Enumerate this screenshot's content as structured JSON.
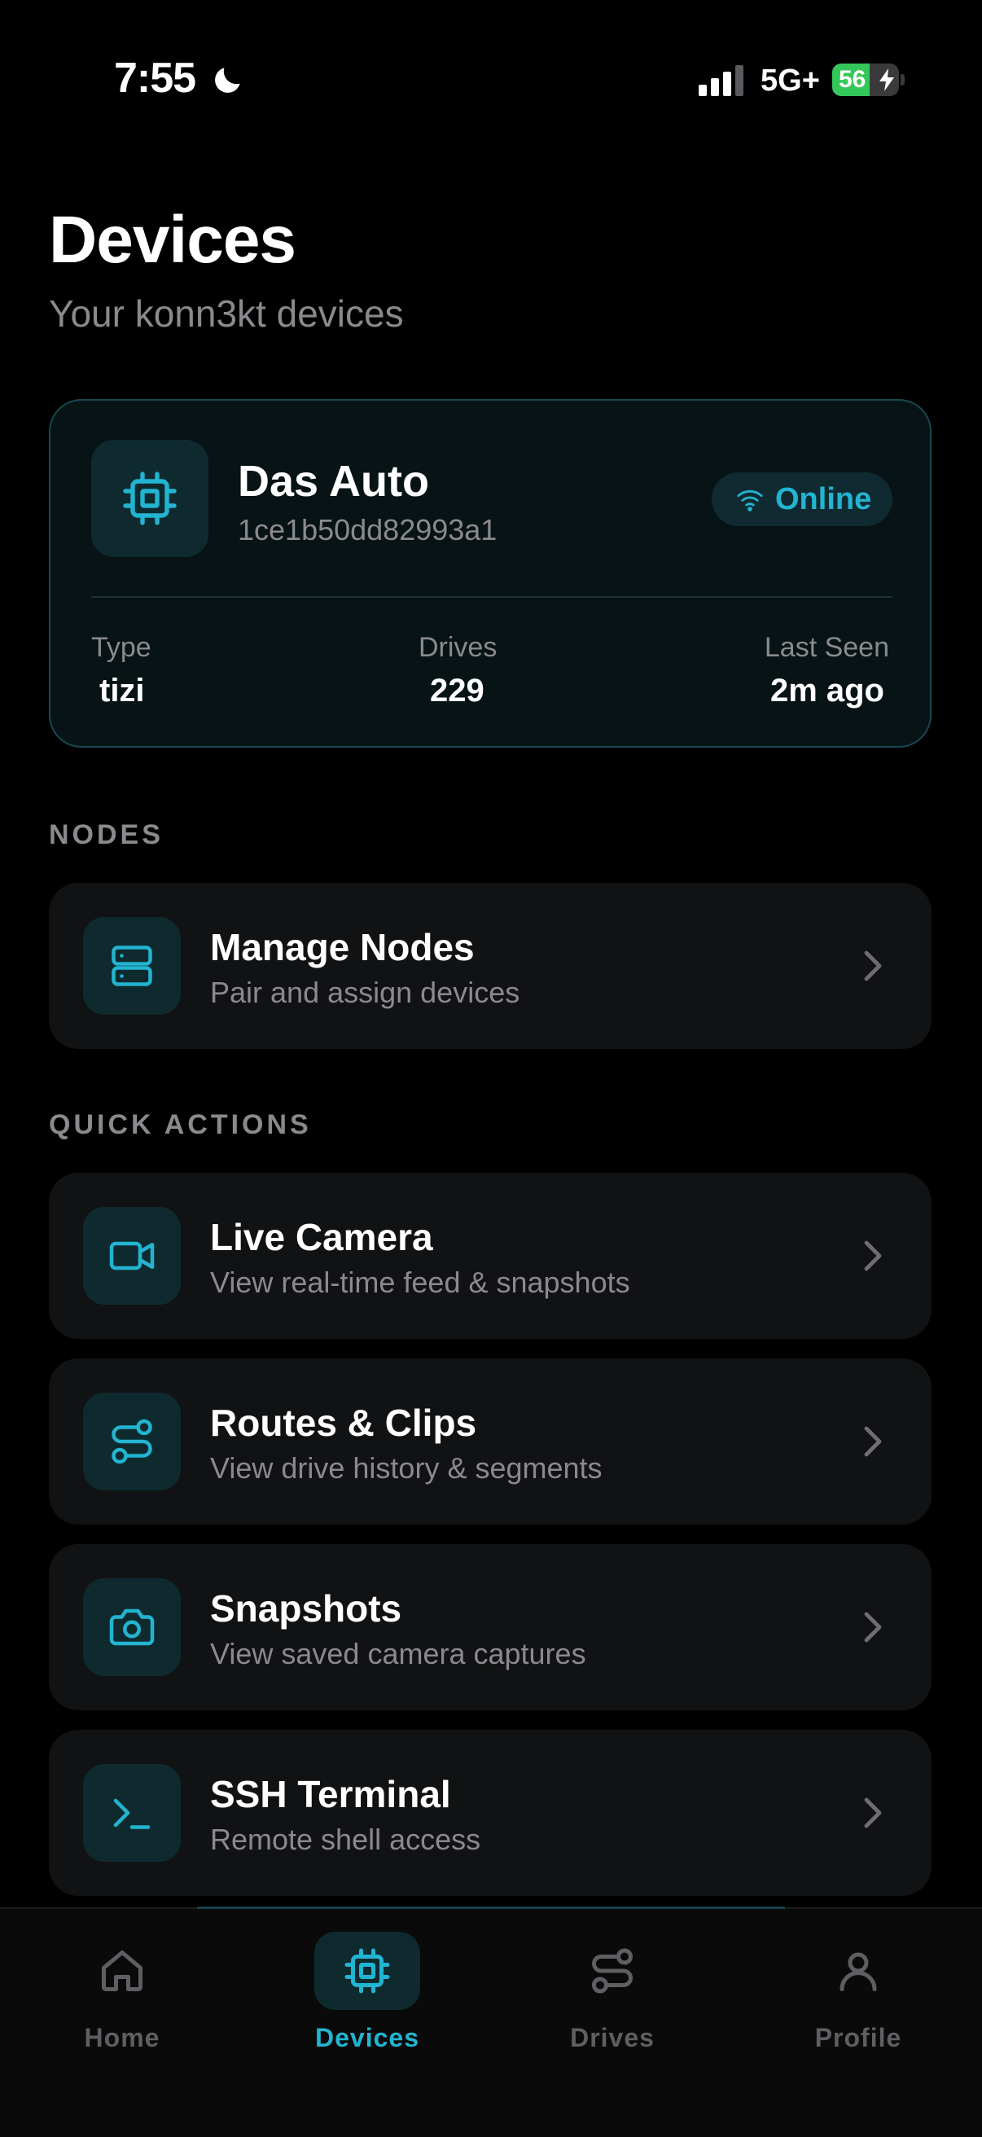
{
  "status_bar": {
    "time": "7:55",
    "network": "5G+",
    "battery_level": "56",
    "battery_fraction": 0.56,
    "moon_icon": "moon-icon",
    "signal_icon": "cellular-signal-icon",
    "bolt_icon": "charging-bolt-icon"
  },
  "header": {
    "title": "Devices",
    "subtitle": "Your konn3kt devices"
  },
  "device_card": {
    "icon": "chip-icon",
    "name": "Das Auto",
    "id": "1ce1b50dd82993a1",
    "status": "Online",
    "status_icon": "wifi-icon",
    "stats": [
      {
        "label": "Type",
        "value": "tizi"
      },
      {
        "label": "Drives",
        "value": "229"
      },
      {
        "label": "Last Seen",
        "value": "2m ago"
      }
    ]
  },
  "nodes_section": {
    "label": "NODES",
    "items": [
      {
        "icon": "server-icon",
        "title": "Manage Nodes",
        "subtitle": "Pair and assign devices"
      }
    ]
  },
  "quick_actions_section": {
    "label": "QUICK ACTIONS",
    "items": [
      {
        "icon": "video-camera-icon",
        "title": "Live Camera",
        "subtitle": "View real-time feed & snapshots"
      },
      {
        "icon": "route-icon",
        "title": "Routes & Clips",
        "subtitle": "View drive history & segments"
      },
      {
        "icon": "camera-icon",
        "title": "Snapshots",
        "subtitle": "View saved camera captures"
      },
      {
        "icon": "terminal-icon",
        "title": "SSH Terminal",
        "subtitle": "Remote shell access"
      }
    ]
  },
  "tab_bar": {
    "active": "Devices",
    "tabs": [
      {
        "label": "Home",
        "icon": "home-icon"
      },
      {
        "label": "Devices",
        "icon": "chip-icon"
      },
      {
        "label": "Drives",
        "icon": "route-icon"
      },
      {
        "label": "Profile",
        "icon": "user-icon"
      }
    ]
  },
  "colors": {
    "background": "#000000",
    "accent": "#22b4d0",
    "card_background": "#111213",
    "card_border": "#164a52",
    "icon_tile": "#0e2a2f",
    "muted_text": "#8a8a8e",
    "battery_green": "#34c759"
  }
}
